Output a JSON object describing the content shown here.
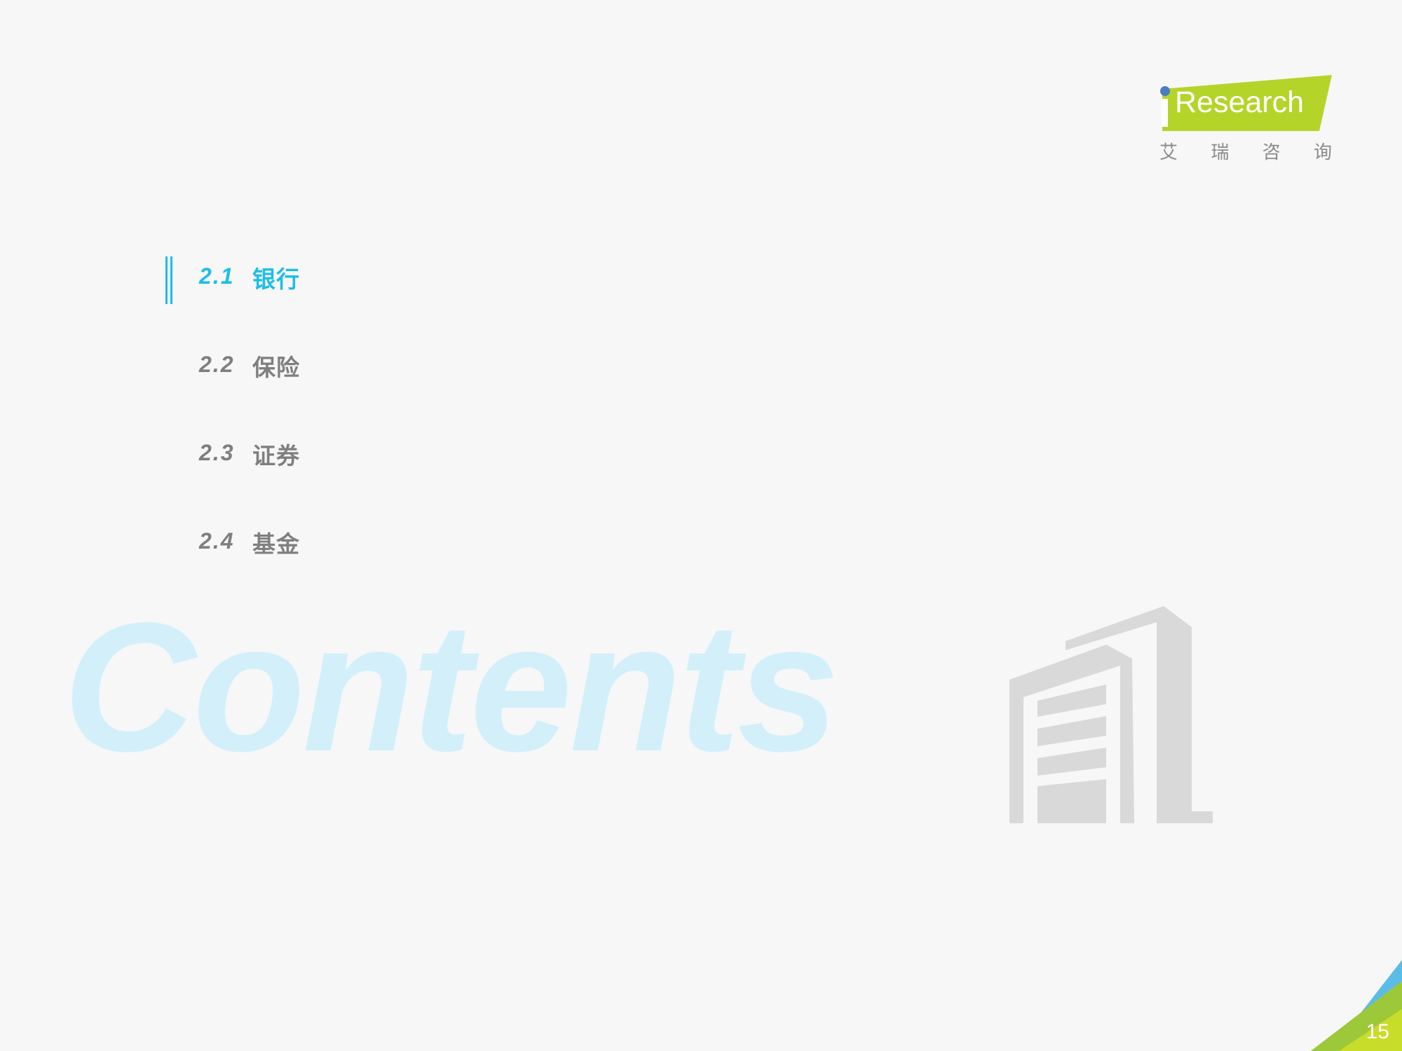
{
  "logo": {
    "brand": "Research",
    "sub_chars": [
      "艾",
      "瑞",
      "咨",
      "询"
    ],
    "colors": {
      "green": "#b5d42a",
      "dot": "#4a7cc1"
    }
  },
  "toc": {
    "items": [
      {
        "number": "2.1",
        "label": "银行",
        "active": true
      },
      {
        "number": "2.2",
        "label": "保险",
        "active": false
      },
      {
        "number": "2.3",
        "label": "证券",
        "active": false
      },
      {
        "number": "2.4",
        "label": "基金",
        "active": false
      }
    ],
    "active_color": "#1ebde8",
    "inactive_color": "#7f7f7f"
  },
  "watermark": "Contents",
  "illustration": "building-icon",
  "page_number": "15",
  "corner_colors": {
    "blue": "#5bbde6",
    "green": "#9cc83a",
    "lime": "#c8dc2a"
  }
}
